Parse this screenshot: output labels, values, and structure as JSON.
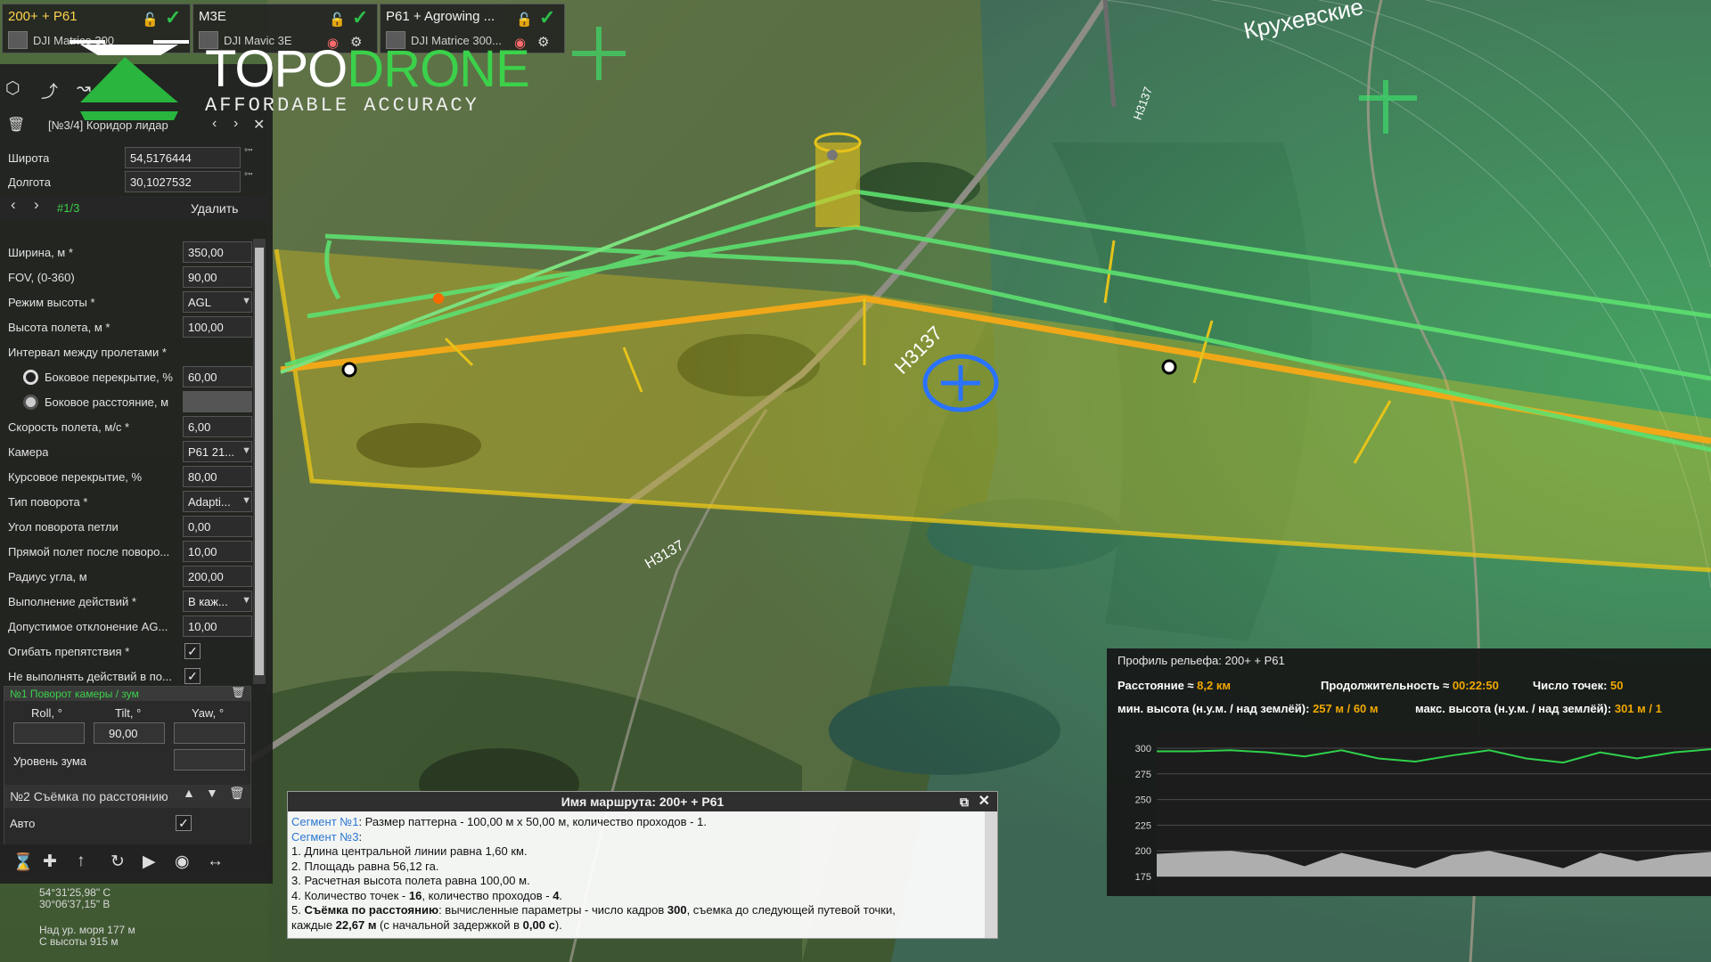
{
  "drones": [
    {
      "title": "200+ + P61",
      "model": "DJI Matrice 300"
    },
    {
      "title": "M3E",
      "model": "DJI Mavic 3E"
    },
    {
      "title": "P61 + Agrowing ...",
      "model": "DJI Matrice 300..."
    }
  ],
  "logo": {
    "brand_a": "TOPO",
    "brand_b": "DRONE",
    "tagline": "AFFORDABLE ACCURACY"
  },
  "map_labels": {
    "road": "H3137",
    "road2": "H3137",
    "road3": "H3137",
    "settlement": "Крухевские"
  },
  "panel": {
    "segment_title": "[№3/4] Коридор лидар",
    "lat_label": "Широта",
    "lat_value": "54,5176444",
    "lon_label": "Долгота",
    "lon_value": "30,1027532",
    "pager": "#1/3",
    "delete_label": "Удалить",
    "fields": [
      {
        "label": "Ширина, м *",
        "value": "350,00"
      },
      {
        "label": "FOV, (0-360)",
        "value": "90,00"
      },
      {
        "label": "Режим высоты *",
        "value": "AGL"
      },
      {
        "label": "Высота полета, м *",
        "value": "100,00"
      },
      {
        "label": "Интервал между пролетами *",
        "value": ""
      },
      {
        "label": "Боковое перекрытие, %",
        "value": "60,00"
      },
      {
        "label": "Боковое расстояние, м",
        "value": ""
      },
      {
        "label": "Скорость полета, м/с *",
        "value": "6,00"
      },
      {
        "label": "Камера",
        "value": "P61 21..."
      },
      {
        "label": "Курсовое перекрытие, %",
        "value": "80,00"
      },
      {
        "label": "Тип поворота *",
        "value": "Adapti..."
      },
      {
        "label": "Угол поворота петли",
        "value": "0,00"
      },
      {
        "label": "Прямой полет после поворо...",
        "value": "10,00"
      },
      {
        "label": "Радиус угла, м",
        "value": "200,00"
      },
      {
        "label": "Выполнение действий *",
        "value": "В кaж..."
      },
      {
        "label": "Допустимое отклонение AG...",
        "value": "10,00"
      },
      {
        "label": "Огибать препятствия *",
        "value": ""
      },
      {
        "label": "Не выполнять действий в по...",
        "value": ""
      }
    ],
    "action1": {
      "title": "№1 Поворот камеры / зум",
      "roll_label": "Roll, °",
      "tilt_label": "Tilt, °",
      "yaw_label": "Yaw, °",
      "roll": "",
      "tilt": "90,00",
      "yaw": "",
      "zoom_label": "Уровень зума",
      "zoom": ""
    },
    "action2": {
      "title": "№2 Съёмка по расстоянию",
      "auto_label": "Авто"
    },
    "coords": {
      "lat": "54°31'25,98\" С",
      "lon": "30°06'37,15\" В",
      "sea": "Над ур. моря 177 м",
      "height": "С высоты 915 м"
    }
  },
  "route": {
    "title": "Имя маршрута: 200+ + P61",
    "seg1_label": "Сегмент №1",
    "seg1_text": ": Размер паттерна - 100,00 м x 50,00 м, количество проходов - 1.",
    "seg3_label": "Сегмент №3",
    "seg3_colon": ":",
    "l1": "1. Длина центральной линии равна 1,60 км.",
    "l2": "2. Площадь равна 56,12 га.",
    "l3": "3. Расчетная высота полета равна 100,00 м.",
    "l4a": "4. Количество точек - ",
    "l4b": "16",
    "l4c": ", количество проходов - ",
    "l4d": "4",
    "l4e": ".",
    "l5a": "5. ",
    "l5b": "Съёмка по расстоянию",
    "l5c": ": вычисленные параметры - число кадров ",
    "l5d": "300",
    "l5e": ", съемка до следующей путевой точки,",
    "l6a": "каждые ",
    "l6b": "22,67 м",
    "l6c": " (с начальной задержкой в ",
    "l6d": "0,00 с",
    "l6e": ")."
  },
  "profile": {
    "title": "Профиль рельефа: 200+ + P61",
    "dist_label": "Расстояние ≈ ",
    "dist": "8,2 км",
    "dur_label": "Продолжительность ≈ ",
    "dur": "00:22:50",
    "pts_label": "Число точек: ",
    "pts": "50",
    "min_label": "мин. высота (н.у.м. / над землёй): ",
    "min": "257 м / 60 м",
    "max_label": "макс. высота (н.у.м. / над землёй): ",
    "max": "301 м / 1",
    "y_ticks": [
      "300",
      "275",
      "250",
      "225",
      "200",
      "175"
    ]
  },
  "chart_data": {
    "type": "area",
    "ylim": [
      175,
      300
    ],
    "series": [
      {
        "values": [
          297,
          297,
          298,
          296,
          292,
          298,
          290,
          287,
          293,
          298,
          290,
          286,
          296,
          290,
          296,
          299
        ]
      },
      {
        "values": [
          197,
          199,
          200,
          196,
          185,
          198,
          190,
          183,
          196,
          200,
          192,
          183,
          198,
          190,
          196,
          199
        ]
      }
    ]
  }
}
